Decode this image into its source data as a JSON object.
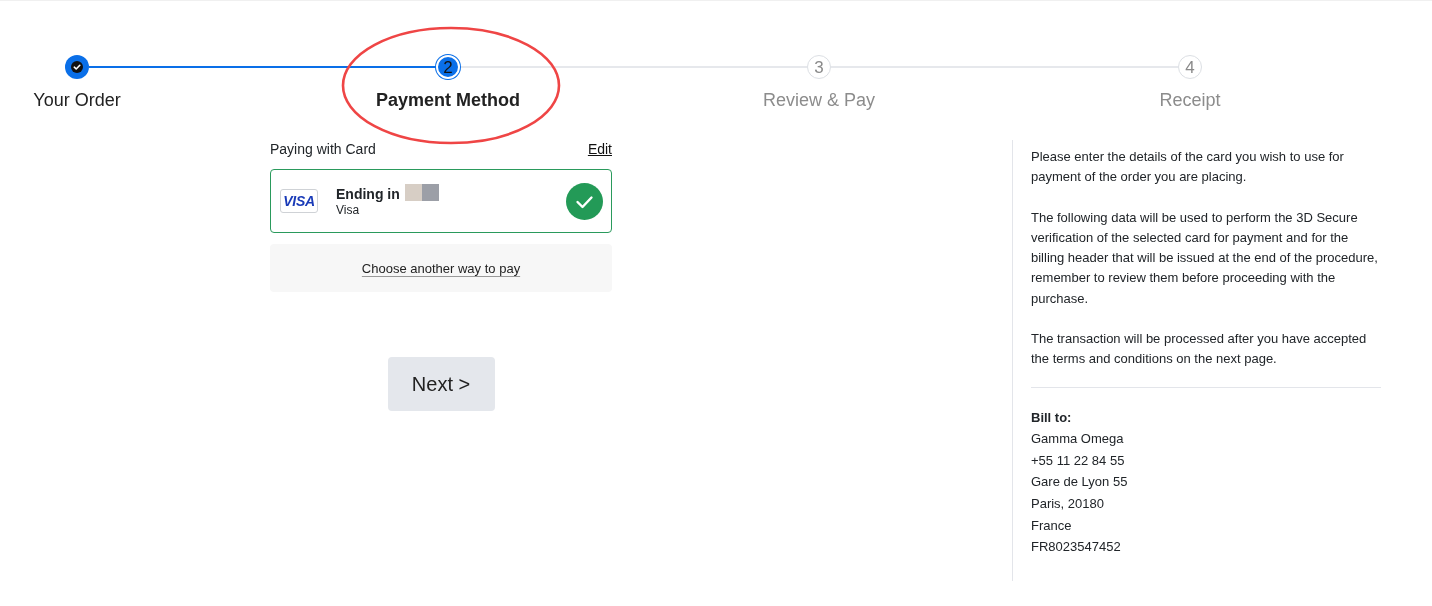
{
  "steps": [
    {
      "label": "Your Order",
      "completed": true,
      "selected": false,
      "circled": false
    },
    {
      "number": "2",
      "label": "Payment Method",
      "completed": false,
      "selected": true,
      "circled": true
    },
    {
      "number": "3",
      "label": "Review & Pay",
      "completed": false,
      "selected": false,
      "circled": false
    },
    {
      "number": "4",
      "label": "Receipt",
      "completed": false,
      "selected": false,
      "circled": false
    }
  ],
  "payment": {
    "heading": "Paying with Card",
    "edit_link": "Edit",
    "card": {
      "logo": "VISA",
      "title": "Ending in",
      "number_masked": true,
      "brand": "Visa",
      "selected": true
    },
    "alternative_link": "Choose another way to pay"
  },
  "next_button": "Next >",
  "info": {
    "paragraphs": [
      "Please enter the details of the card you wish to use for payment of the order you are placing.",
      "The following data will be used to perform the 3D Secure verification of the selected card for payment and for the billing header that will be issued at the end of the procedure, remember to review them before proceeding with the purchase.",
      "The transaction will be processed after you have accepted the terms and conditions on the next page."
    ],
    "bill_to": {
      "heading": "Bill to:",
      "lines": [
        "Gamma Omega",
        "+55 11 22 84 55",
        "Gare de Lyon 55",
        "Paris, 20180",
        "France",
        "FR8023547452"
      ]
    }
  }
}
